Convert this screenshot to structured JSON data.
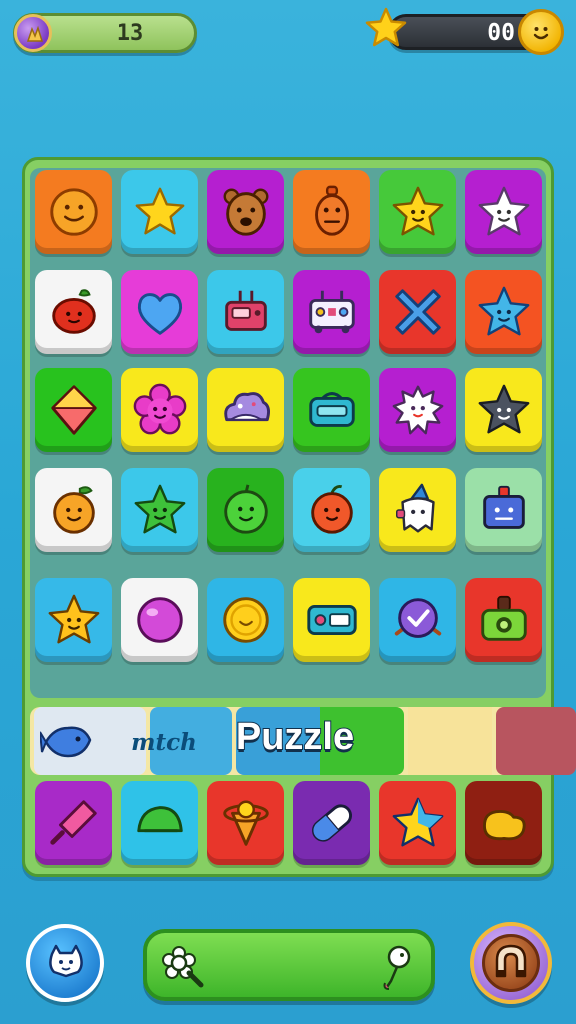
{
  "hud": {
    "left_value": "13",
    "right_value": "00",
    "left_icon": "purple-gem-icon",
    "right_icons": [
      "star-icon",
      "smiley-coin-icon"
    ]
  },
  "board": {
    "rows": [
      [
        {
          "color": "#f47b20",
          "icon": "orange-smiley-icon"
        },
        {
          "color": "#3cc8ea",
          "icon": "yellow-star-icon"
        },
        {
          "color": "#b51fd0",
          "icon": "bear-face-icon"
        },
        {
          "color": "#f47b20",
          "icon": "orange-creature-icon"
        },
        {
          "color": "#46c93a",
          "icon": "yellow-star-face-icon"
        },
        {
          "color": "#b51fd0",
          "icon": "white-star-face-icon"
        }
      ],
      [
        {
          "color": "#f5f5f5",
          "icon": "red-tomato-icon"
        },
        {
          "color": "#e63cd8",
          "icon": "blue-heart-icon"
        },
        {
          "color": "#3cc8ea",
          "icon": "red-robot-icon"
        },
        {
          "color": "#b51fd0",
          "icon": "rover-robot-icon"
        },
        {
          "color": "#e8362b",
          "icon": "blue-cross-icon"
        },
        {
          "color": "#f45322",
          "icon": "blue-star-face-icon"
        }
      ],
      [
        {
          "color": "#28c21e",
          "icon": "diamond-kite-icon"
        },
        {
          "color": "#f8e81c",
          "icon": "pink-flower-icon"
        },
        {
          "color": "#f8e81c",
          "icon": "purple-cloud-icon"
        },
        {
          "color": "#36c51f",
          "icon": "teal-boombox-icon"
        },
        {
          "color": "#b51fd0",
          "icon": "white-spiky-face-icon"
        },
        {
          "color": "#f8e81c",
          "icon": "dark-star-face-icon"
        }
      ],
      [
        {
          "color": "#f5f5f5",
          "icon": "orange-fruit-face-icon"
        },
        {
          "color": "#3cc8ea",
          "icon": "green-star-face-icon"
        },
        {
          "color": "#28b21e",
          "icon": "green-apple-face-icon"
        },
        {
          "color": "#49d0ea",
          "icon": "orange-apple-face-icon"
        },
        {
          "color": "#f8e81c",
          "icon": "wizard-ghost-icon"
        },
        {
          "color": "#9be0a8",
          "icon": "blue-robot-face-icon"
        }
      ],
      [
        {
          "color": "#36b9e8",
          "icon": "orange-star-face-icon"
        },
        {
          "color": "#f5f5f5",
          "icon": "pink-bubble-icon"
        },
        {
          "color": "#2fb6e6",
          "icon": "yellow-coin-icon"
        },
        {
          "color": "#f8e81c",
          "icon": "teal-card-icon"
        },
        {
          "color": "#2fb6e6",
          "icon": "purple-shield-icon"
        },
        {
          "color": "#e8362b",
          "icon": "green-camera-icon"
        }
      ]
    ]
  },
  "title_strip": {
    "small_text": "mtch",
    "big_text": "Puzzle",
    "left_icon": "blue-fish-icon"
  },
  "bottom_row": [
    {
      "color": "#a82ac8",
      "icon": "pink-popsicle-icon"
    },
    {
      "color": "#2fc2e8",
      "icon": "green-leaf-icon"
    },
    {
      "color": "#e8362b",
      "icon": "planet-cone-icon"
    },
    {
      "color": "#7a2bb0",
      "icon": "capsule-icon"
    },
    {
      "color": "#e8362b",
      "icon": "blue-yellow-star-icon"
    },
    {
      "color": "#8f1f12",
      "icon": "yellow-bean-icon"
    }
  ],
  "controls": {
    "left_button_icon": "cat-chat-icon",
    "search_icon": "flower-magnifier-icon",
    "search_right_icon": "chick-icon",
    "right_button_icon": "magnet-icon"
  }
}
